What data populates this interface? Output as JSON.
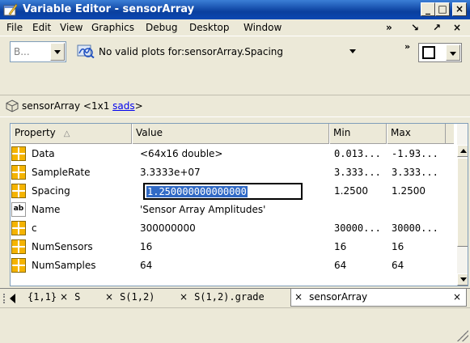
{
  "window": {
    "title": "Variable Editor - sensorArray"
  },
  "menu": {
    "items": [
      "File",
      "Edit",
      "View",
      "Graphics",
      "Debug",
      "Desktop",
      "Window"
    ],
    "overflow": "»",
    "dock": "↘",
    "undock": "↗",
    "close": "×"
  },
  "toolbar": {
    "combo_value": "B...",
    "plot_message": "No valid plots for:sensorArray.Spacing",
    "overflow": "»"
  },
  "variable": {
    "name_prefix": "sensorArray <1x1 ",
    "class_link": "sads",
    "name_suffix": ">"
  },
  "table": {
    "headers": {
      "property": "Property",
      "value": "Value",
      "min": "Min",
      "max": "Max"
    },
    "rows": [
      {
        "icon": "grid-icon",
        "property": "Data",
        "value": "<64x16 double>",
        "min": "0.013...",
        "max": "-1.93..."
      },
      {
        "icon": "grid-icon",
        "property": "SampleRate",
        "value": "3.3333e+07",
        "min": "3.333...",
        "max": "3.333..."
      },
      {
        "icon": "grid-icon",
        "property": "Spacing",
        "value": "1.250000000000000",
        "min": "1.2500",
        "max": "1.2500",
        "editing": true
      },
      {
        "icon": "ab-icon",
        "property": "Name",
        "value": "'Sensor Array Amplitudes'",
        "min": "",
        "max": ""
      },
      {
        "icon": "grid-icon",
        "property": "c",
        "value": "300000000",
        "min": "30000...",
        "max": "30000..."
      },
      {
        "icon": "grid-icon",
        "property": "NumSensors",
        "value": "16",
        "min": "16",
        "max": "16"
      },
      {
        "icon": "grid-icon",
        "property": "NumSamples",
        "value": "64",
        "min": "64",
        "max": "64"
      }
    ]
  },
  "tabs": [
    {
      "label": "{1,1}",
      "active": false
    },
    {
      "label": "S",
      "active": false
    },
    {
      "label": "S(1,2)",
      "active": false
    },
    {
      "label": "S(1,2).grade",
      "active": false
    },
    {
      "label": "sensorArray",
      "active": true
    }
  ],
  "ab_icon_text": "ab"
}
